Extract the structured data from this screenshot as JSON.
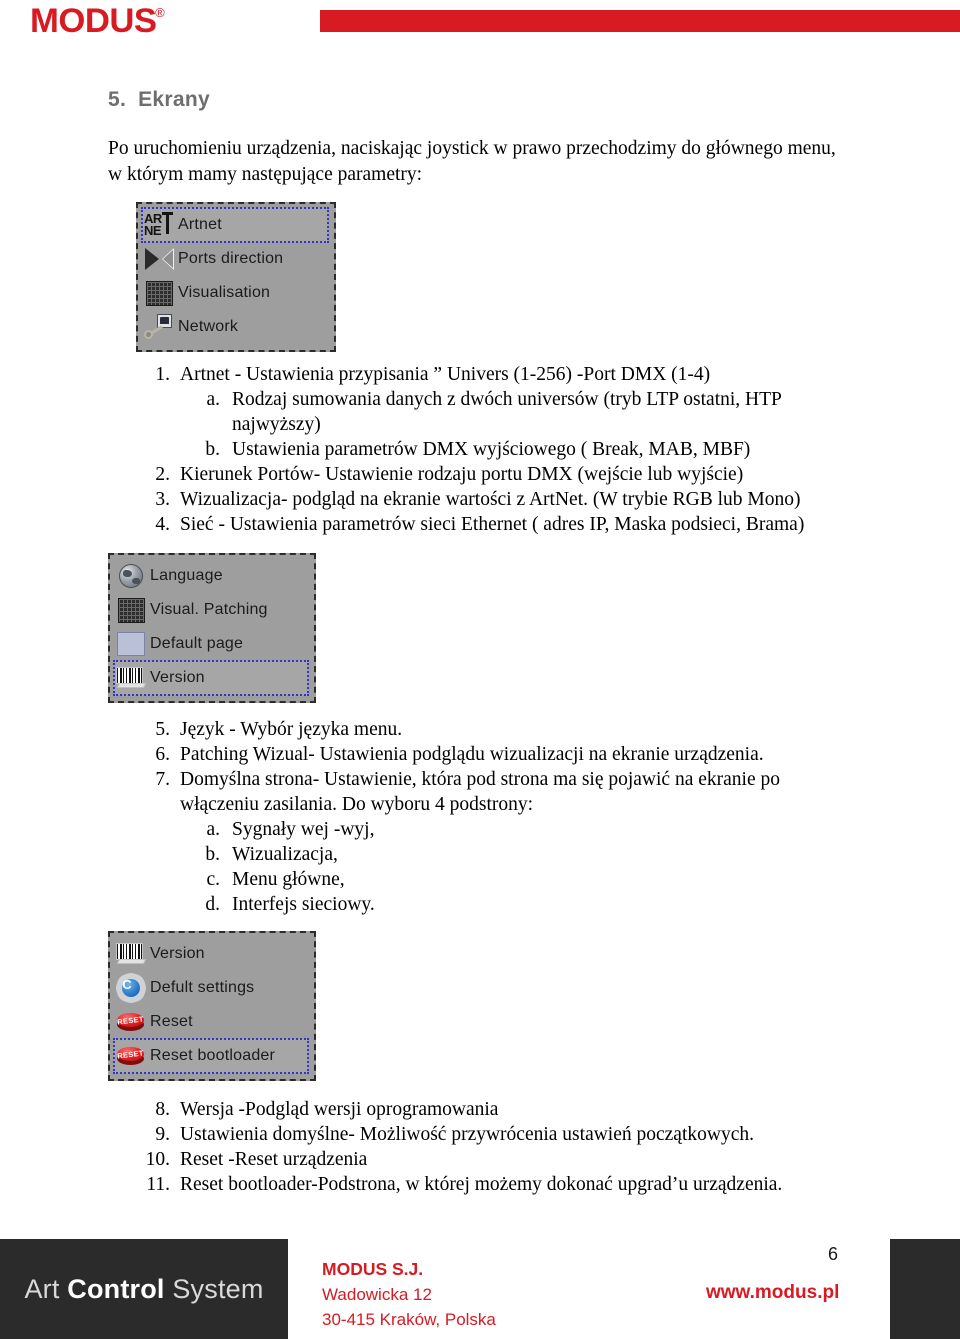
{
  "header": {
    "logo_text": "MODUS",
    "logo_registered": "®"
  },
  "section": {
    "number": "5.",
    "title": "Ekrany"
  },
  "intro": {
    "line1": "Po uruchomieniu urządzenia, naciskając joystick w prawo przechodzimy do głównego menu,",
    "line2": "w którym mamy następujące parametry:"
  },
  "menu_screens": [
    {
      "name": "main-menu",
      "items": [
        {
          "icon": "artnet-logo-icon",
          "label": "Artnet",
          "selected": true
        },
        {
          "icon": "ports-direction-icon",
          "label": "Ports direction",
          "selected": false
        },
        {
          "icon": "visualisation-grid-icon",
          "label": "Visualisation",
          "selected": false
        },
        {
          "icon": "network-key-icon",
          "label": "Network",
          "selected": false
        }
      ]
    },
    {
      "name": "settings-menu",
      "items": [
        {
          "icon": "globe-icon",
          "label": "Language",
          "selected": false
        },
        {
          "icon": "visualisation-grid-icon",
          "label": "Visual. Patching",
          "selected": false
        },
        {
          "icon": "screen-icon",
          "label": "Default page",
          "selected": false
        },
        {
          "icon": "barcode-icon",
          "label": "Version",
          "selected": true
        }
      ]
    },
    {
      "name": "service-menu",
      "items": [
        {
          "icon": "barcode-icon",
          "label": "Version",
          "selected": false
        },
        {
          "icon": "gear-icon",
          "label": "Defult settings",
          "selected": false
        },
        {
          "icon": "reset-button-icon",
          "label": "Reset",
          "selected": false
        },
        {
          "icon": "reset-button-icon",
          "label": "Reset bootloader",
          "selected": true
        }
      ]
    }
  ],
  "list_block_1": [
    {
      "level": 1,
      "marker": "1.",
      "text": "Artnet - Ustawienia przypisania ” Univers (1-256) -Port DMX (1-4)"
    },
    {
      "level": 2,
      "marker": "a.",
      "text": "Rodzaj sumowania danych z dwóch universów (tryb LTP ostatni, HTP"
    },
    {
      "level": 0,
      "marker": "",
      "text": "najwyższy)"
    },
    {
      "level": 2,
      "marker": "b.",
      "text": "Ustawienia parametrów DMX wyjściowego ( Break, MAB, MBF)"
    },
    {
      "level": 1,
      "marker": "2.",
      "text": "Kierunek Portów- Ustawienie rodzaju portu DMX (wejście lub wyjście)"
    },
    {
      "level": 1,
      "marker": "3.",
      "text": "Wizualizacja- podgląd na ekranie wartości z ArtNet. (W trybie RGB lub Mono)"
    },
    {
      "level": 1,
      "marker": "4.",
      "text": "Sieć - Ustawienia parametrów sieci Ethernet ( adres IP, Maska podsieci, Brama)"
    }
  ],
  "list_block_2": [
    {
      "level": 1,
      "marker": "5.",
      "text": "Język - Wybór języka menu."
    },
    {
      "level": 1,
      "marker": "6.",
      "text": "Patching Wizual- Ustawienia podglądu wizualizacji na ekranie urządzenia."
    },
    {
      "level": 1,
      "marker": "7.",
      "text": "Domyślna strona- Ustawienie, która pod strona ma się pojawić na ekranie po"
    },
    {
      "level": 0,
      "marker": "",
      "text": "włączeniu zasilania. Do wyboru 4 podstrony:"
    },
    {
      "level": 2,
      "marker": "a.",
      "text": "Sygnały wej -wyj,"
    },
    {
      "level": 2,
      "marker": "b.",
      "text": "Wizualizacja,"
    },
    {
      "level": 2,
      "marker": "c.",
      "text": "Menu główne,"
    },
    {
      "level": 2,
      "marker": "d.",
      "text": "Interfejs sieciowy."
    }
  ],
  "list_block_3": [
    {
      "level": 1,
      "marker": "8.",
      "text": "Wersja -Podgląd wersji oprogramowania"
    },
    {
      "level": 1,
      "marker": "9.",
      "text": "Ustawienia domyślne- Możliwość przywrócenia ustawień początkowych."
    },
    {
      "level": 1,
      "marker": "10.",
      "text": "Reset -Reset urządzenia"
    },
    {
      "level": 1,
      "marker": "11.",
      "text": "Reset bootloader-Podstrona, w której możemy dokonać upgrad’u urządzenia."
    }
  ],
  "footer": {
    "brand_left": "Art",
    "brand_mid": "Control",
    "brand_right": "System",
    "company": "MODUS S.J.",
    "street": "Wadowicka 12",
    "city": "30-415 Kraków, Polska",
    "url": "www.modus.pl",
    "page_number": "6",
    "reset_icon_text": "RESET",
    "gear_letter": "C",
    "artnet_top": "AR",
    "artnet_bottom": "NE"
  },
  "colors": {
    "brand_red": "#d81a22",
    "footer_dark": "#2b2b2b",
    "lcd_gray": "#9e9e9e",
    "selection_blue": "#3434c8",
    "title_gray": "#6e6e6e"
  }
}
